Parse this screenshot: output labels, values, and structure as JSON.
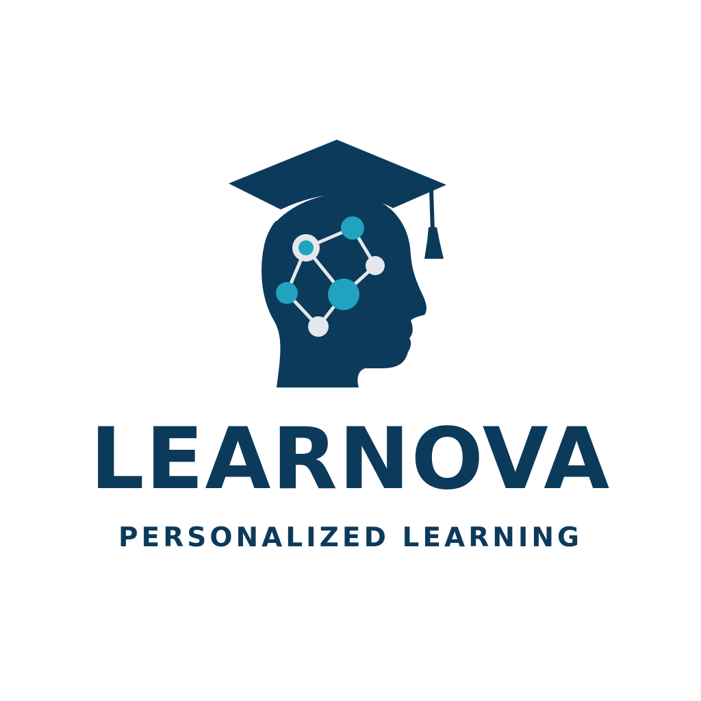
{
  "brand": {
    "name": "LEARNOVA",
    "tagline": "PERSONALIZED LEARNING"
  },
  "logo": {
    "icon": "graduate-head-network-icon",
    "parts": [
      "graduation-cap-icon",
      "head-profile-icon",
      "neural-network-icon"
    ]
  },
  "colors": {
    "primary": "#0c3a5b",
    "accent": "#1fa3bf",
    "node_light": "#e4e7eb",
    "background": "#ffffff"
  }
}
